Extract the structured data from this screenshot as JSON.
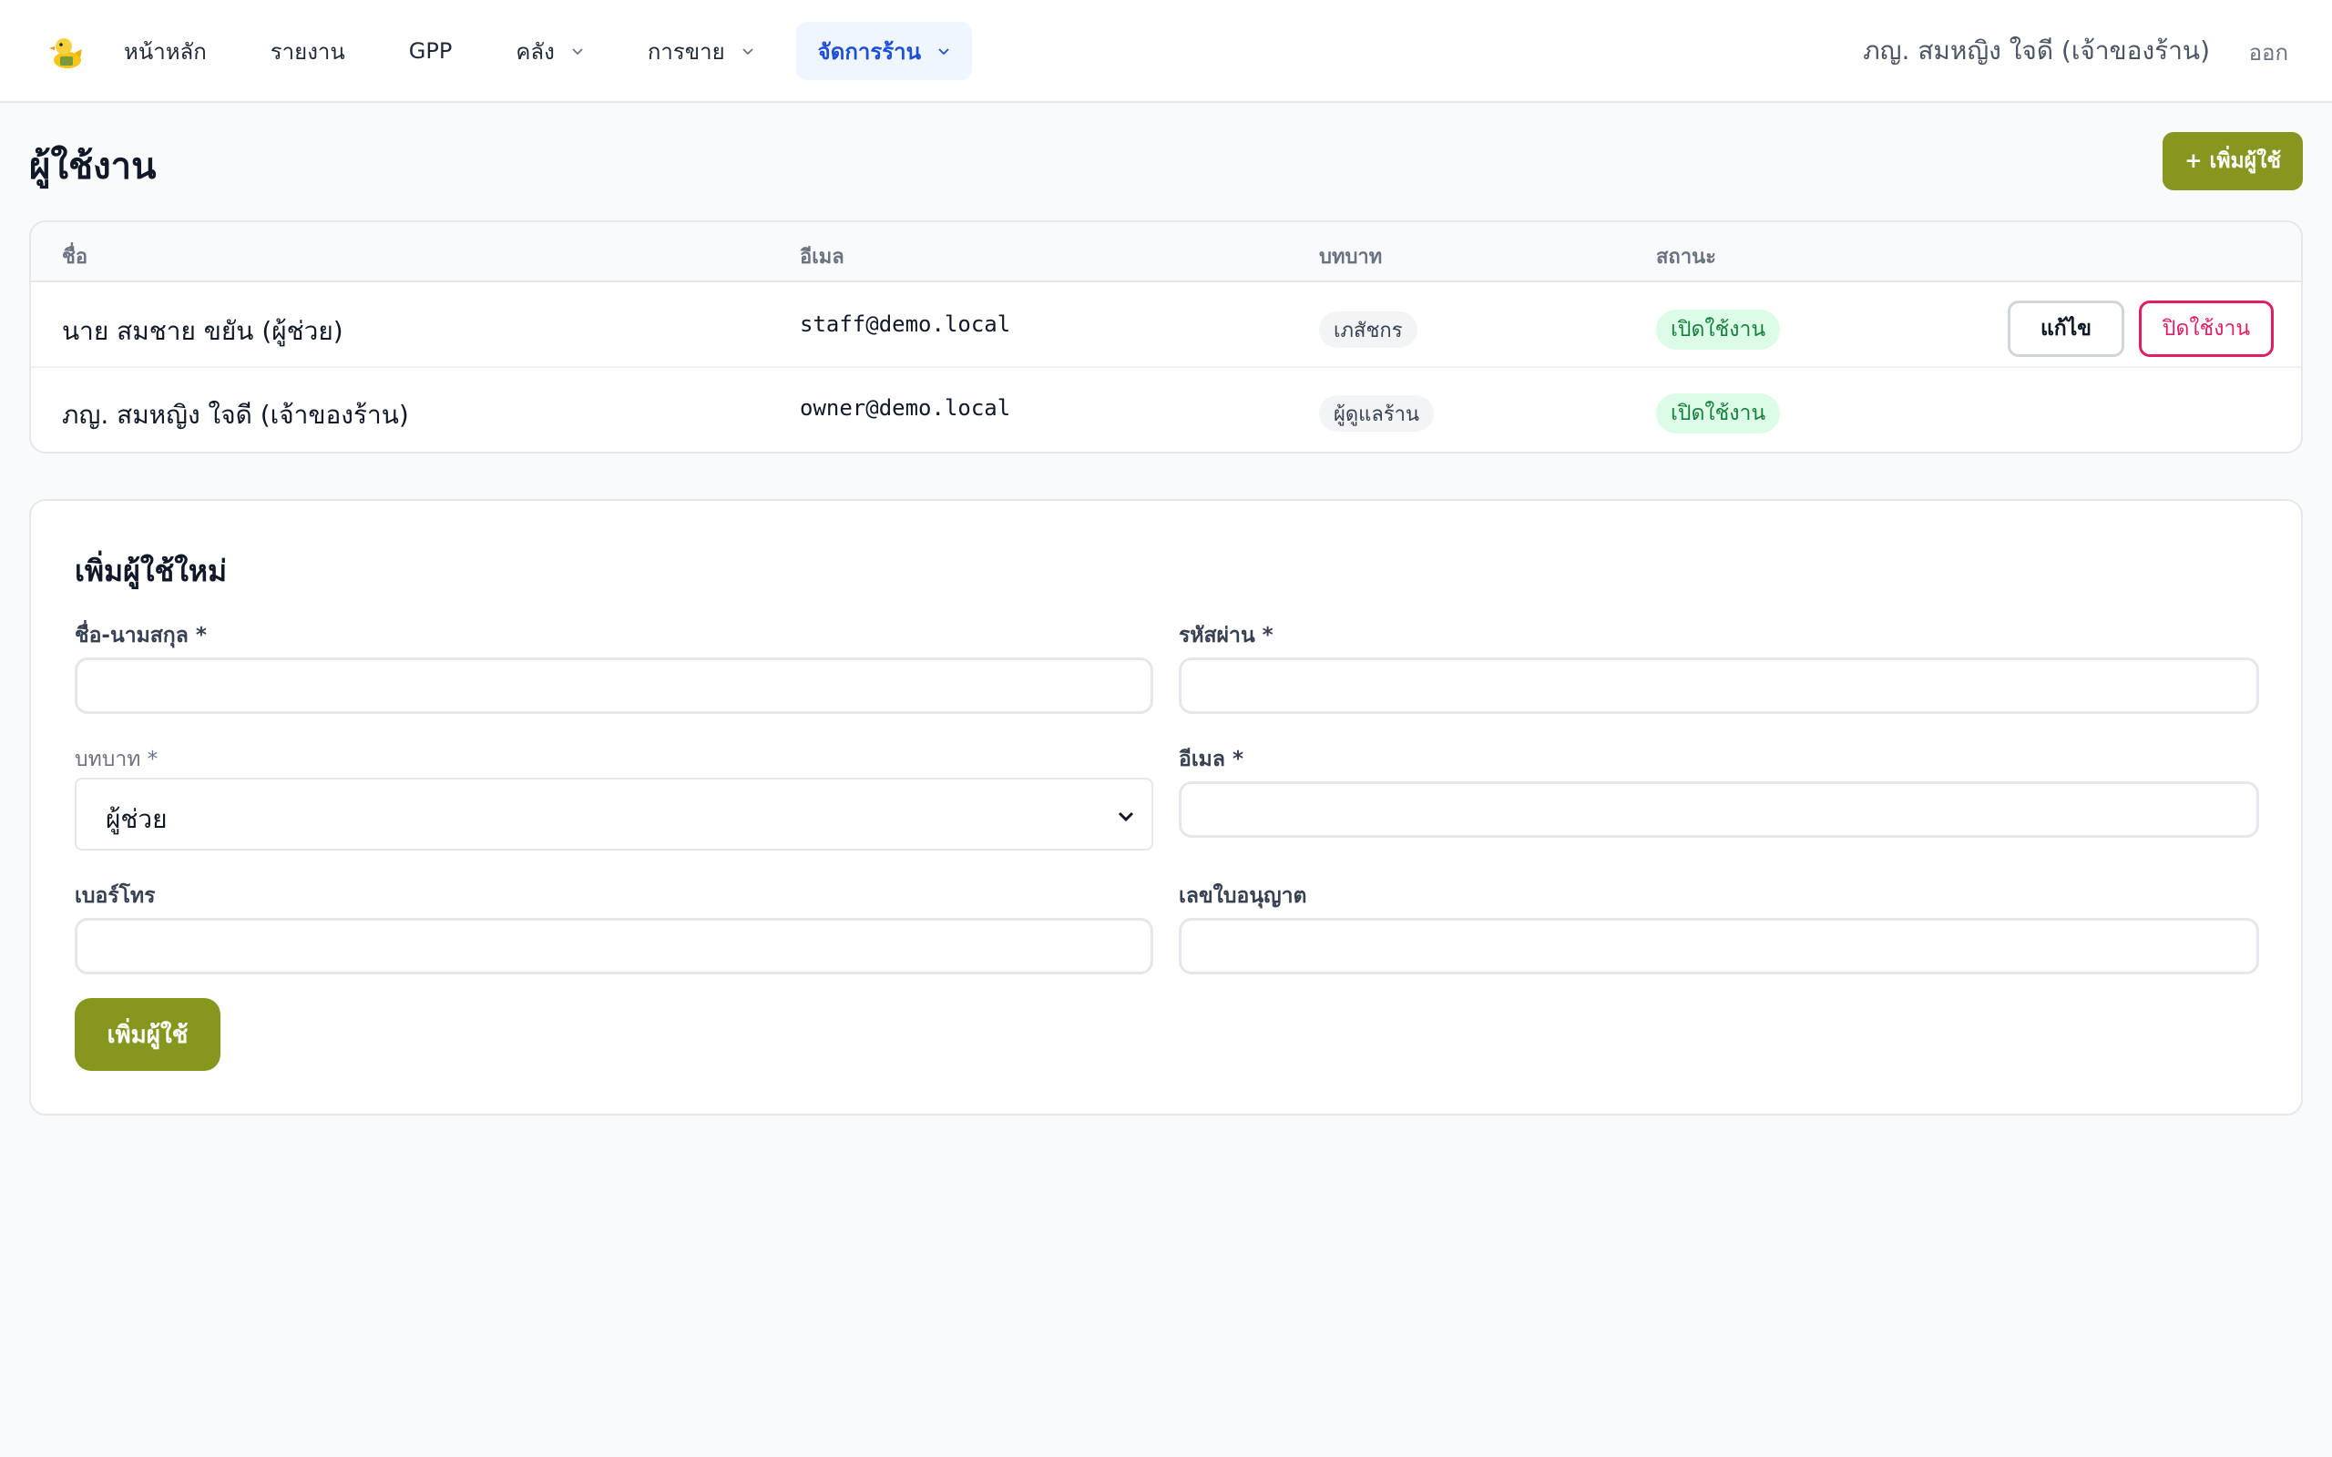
{
  "nav": {
    "logo_icon": "duck-logo-icon",
    "items": [
      {
        "label": "หน้าหลัก"
      },
      {
        "label": "รายงาน"
      },
      {
        "label": "GPP"
      },
      {
        "label": "คลัง"
      },
      {
        "label": "การขาย"
      },
      {
        "label": "จัดการร้าน"
      }
    ],
    "user_name": "ภญ. สมหญิง ใจดี (เจ้าของร้าน)",
    "logout_label": "ออก"
  },
  "page": {
    "title": "ผู้ใช้งาน",
    "add_button_label": "+ เพิ่มผู้ใช้"
  },
  "table": {
    "columns": [
      "ชื่อ",
      "อีเมล",
      "บทบาท",
      "สถานะ"
    ],
    "rows": [
      {
        "name": "นาย สมชาย ขยัน (ผู้ช่วย)",
        "email": "staff@demo.local",
        "role": "เภสัชกร",
        "status": "เปิดใช้งาน",
        "edit_label": "แก้ไข",
        "disable_label": "ปิดใช้งาน"
      },
      {
        "name": "ภญ. สมหญิง ใจดี (เจ้าของร้าน)",
        "email": "owner@demo.local",
        "role": "ผู้ดูแลร้าน",
        "status": "เปิดใช้งาน"
      }
    ]
  },
  "form": {
    "title": "เพิ่มผู้ใช้ใหม่",
    "fullname_label": "ชื่อ-นามสกุล *",
    "password_label": "รหัสผ่าน *",
    "role_label": "บทบาท *",
    "role_value": "ผู้ช่วย",
    "email_label": "อีเมล *",
    "phone_label": "เบอร์โทร",
    "license_label": "เลขใบอนุญาต",
    "submit_label": "เพิ่มผู้ใช้"
  },
  "colors": {
    "accent": "#86961f",
    "active_nav": "#1d4ed8",
    "danger": "#e11d63",
    "success_bg": "#dcfce7",
    "success_text": "#15803d"
  }
}
